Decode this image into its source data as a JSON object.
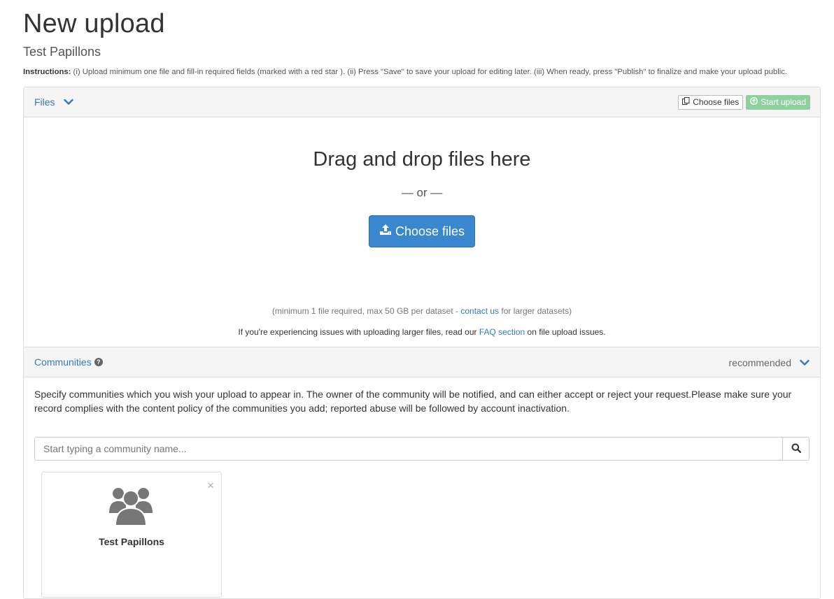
{
  "page": {
    "title": "New upload",
    "subtitle": "Test Papillons",
    "instructions_label": "Instructions:",
    "instructions_text": " (i) Upload minimum one file and fill-in required fields (marked with a red star ). (ii) Press \"Save\" to save your upload for editing later. (iii) When ready, press \"Publish\" to finalize and make your upload public."
  },
  "files": {
    "heading": "Files",
    "choose_files_small": "Choose files",
    "start_upload": "Start upload",
    "drop_title": "Drag and drop files here",
    "or_text": "— or —",
    "choose_files_button": "Choose files",
    "note_prefix": "(minimum 1 file required, max 50 GB per dataset - ",
    "note_link": "contact us",
    "note_suffix": " for larger datasets)",
    "issue_prefix": "If you're experiencing issues with uploading larger files, read our ",
    "issue_link": "FAQ section",
    "issue_suffix": " on file upload issues."
  },
  "communities": {
    "heading": "Communities",
    "recommended": "recommended",
    "description": "Specify communities which you wish your upload to appear in. The owner of the community will be notified, and can either accept or reject your request.Please make sure your record complies with the content policy of the communities you add; reported abuse will be followed by account inactivation.",
    "search_placeholder": "Start typing a community name...",
    "selected": [
      {
        "name": "Test Papillons",
        "close": "×"
      }
    ]
  },
  "colors": {
    "link": "#337ab7",
    "primary": "#3a87cf",
    "success": "#8fd19e"
  }
}
